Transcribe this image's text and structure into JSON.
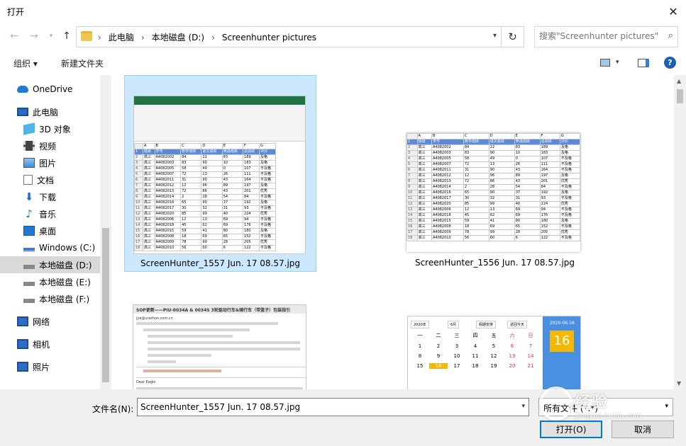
{
  "window": {
    "title": "打开"
  },
  "address": {
    "crumbs": [
      "此电脑",
      "本地磁盘 (D:)",
      "Screenhunter pictures"
    ]
  },
  "search": {
    "placeholder": "搜索\"Screenhunter pictures\""
  },
  "toolbar": {
    "organize": "组织 ▾",
    "new_folder": "新建文件夹"
  },
  "sidebar": {
    "items": [
      {
        "label": "OneDrive",
        "icon": "cloud-icon"
      },
      {
        "label": "此电脑",
        "icon": "computer-icon"
      },
      {
        "label": "3D 对象",
        "icon": "cube-icon"
      },
      {
        "label": "视频",
        "icon": "film-icon"
      },
      {
        "label": "图片",
        "icon": "picture-icon"
      },
      {
        "label": "文档",
        "icon": "document-icon"
      },
      {
        "label": "下载",
        "icon": "download-icon"
      },
      {
        "label": "音乐",
        "icon": "music-icon"
      },
      {
        "label": "桌面",
        "icon": "desktop-icon"
      },
      {
        "label": "Windows (C:)",
        "icon": "windows-drive-icon"
      },
      {
        "label": "本地磁盘 (D:)",
        "icon": "drive-icon"
      },
      {
        "label": "本地磁盘 (E:)",
        "icon": "drive-icon"
      },
      {
        "label": "本地磁盘 (F:)",
        "icon": "drive-icon"
      },
      {
        "label": "网络",
        "icon": "network-icon"
      },
      {
        "label": "相机",
        "icon": "camera-icon"
      },
      {
        "label": "照片",
        "icon": "photos-icon"
      }
    ]
  },
  "files": [
    {
      "name": "ScreenHunter_1557 Jun. 17 08.57.jpg",
      "selected": true
    },
    {
      "name": "ScreenHunter_1556 Jun. 17 08.57.jpg",
      "selected": false
    }
  ],
  "thumb_sheet": {
    "headers": [
      "",
      "班级",
      "学号",
      "数学成绩",
      "语文成绩",
      "英语成绩",
      "总成绩",
      "评价"
    ],
    "col_letters": [
      "",
      "A",
      "B",
      "C",
      "D",
      "E",
      "F",
      "G"
    ],
    "rows": [
      [
        "2",
        "高三",
        "A4082002",
        "84",
        "22",
        "83",
        "189",
        "及格"
      ],
      [
        "3",
        "高三",
        "A4082003",
        "83",
        "90",
        "10",
        "183",
        "及格"
      ],
      [
        "4",
        "高三",
        "A4082005",
        "58",
        "49",
        "0",
        "107",
        "不及格"
      ],
      [
        "5",
        "高三",
        "A4082007",
        "72",
        "13",
        "26",
        "111",
        "不及格"
      ],
      [
        "6",
        "高三",
        "A4082011",
        "31",
        "90",
        "43",
        "164",
        "不及格"
      ],
      [
        "7",
        "高三",
        "A4082012",
        "12",
        "96",
        "89",
        "197",
        "及格"
      ],
      [
        "8",
        "高三",
        "A4082013",
        "72",
        "86",
        "43",
        "201",
        "优秀"
      ],
      [
        "9",
        "高三",
        "A4082014",
        "2",
        "28",
        "54",
        "84",
        "不及格"
      ],
      [
        "10",
        "高三",
        "A4082016",
        "65",
        "90",
        "37",
        "192",
        "及格"
      ],
      [
        "11",
        "高三",
        "A4082017",
        "30",
        "32",
        "31",
        "93",
        "不及格"
      ],
      [
        "12",
        "高三",
        "A4082020",
        "85",
        "99",
        "40",
        "224",
        "优秀"
      ],
      [
        "13",
        "高三",
        "A4082006",
        "12",
        "13",
        "69",
        "94",
        "不及格"
      ],
      [
        "14",
        "高三",
        "A4082018",
        "45",
        "62",
        "69",
        "176",
        "不及格"
      ],
      [
        "15",
        "高三",
        "A4082015",
        "59",
        "41",
        "80",
        "180",
        "及格"
      ],
      [
        "16",
        "高三",
        "A4082008",
        "18",
        "69",
        "65",
        "152",
        "不及格"
      ],
      [
        "17",
        "高三",
        "A4082009",
        "78",
        "99",
        "28",
        "205",
        "优秀"
      ],
      [
        "18",
        "高三",
        "A4082010",
        "56",
        "60",
        "6",
        "122",
        "不及格"
      ]
    ]
  },
  "thumb_email": {
    "subject": "SOP更新——PIU-0034A & 0034S 3轮驱动行车&骑行车（带篮子）包装指引",
    "from": "jye@urathon.com.cn",
    "greeting": "Dear Eagle"
  },
  "thumb_calendar": {
    "year": "2020年",
    "month": "6月",
    "holiday": "假期安排",
    "today": "返回今天",
    "date_label": "2020-06-16",
    "day": "16",
    "weekdays": [
      "一",
      "二",
      "三",
      "四",
      "五",
      "六",
      "日"
    ],
    "days": [
      "1",
      "2",
      "3",
      "4",
      "5",
      "6",
      "7",
      "8",
      "9",
      "10",
      "11",
      "12",
      "13",
      "14",
      "15",
      "16",
      "17",
      "18",
      "19",
      "20",
      "21"
    ]
  },
  "bottom": {
    "filename_label": "文件名(N):",
    "filename_value": "ScreenHunter_1557 Jun. 17 08.57.jpg",
    "filetype_value": "所有文件 (*.*)",
    "open_label": "打开(O)",
    "cancel_label": "取消"
  },
  "watermark": {
    "text": "经验",
    "url": "jingyan.baidu.com"
  }
}
